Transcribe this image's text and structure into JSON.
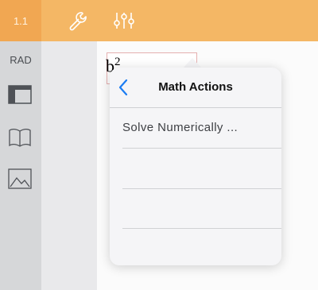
{
  "toolbar": {
    "page_tab": "1.1",
    "icons": [
      "wrench-icon",
      "sliders-icon"
    ],
    "accent": "#f4b765"
  },
  "sidebar": {
    "angle_mode": "RAD",
    "icons": [
      "panel-layout-icon",
      "book-icon",
      "image-icon"
    ]
  },
  "popover": {
    "title": "Math Actions",
    "back_icon": "chevron-left-icon",
    "items": [
      {
        "label": "Solve Numerically ..."
      },
      {
        "label": ""
      },
      {
        "label": ""
      }
    ]
  }
}
